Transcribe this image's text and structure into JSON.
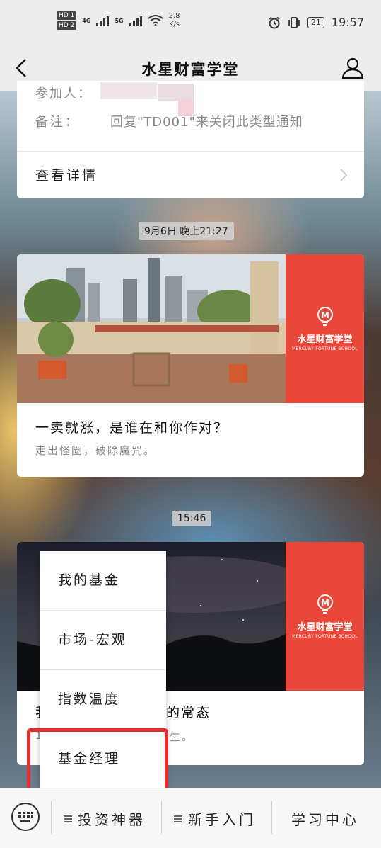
{
  "status_bar": {
    "hd1": "HD 1",
    "hd2": "HD 2",
    "net1": "4G",
    "net2": "5G",
    "speed": "2.8",
    "speed_unit": "K/s",
    "battery": "21",
    "time": "19:57"
  },
  "title_bar": {
    "title": "水星财富学堂"
  },
  "notice_card": {
    "partial_row_label": "参加人：",
    "remark_label": "备注：",
    "remark_value": "回复\"TD001\"来关闭此类型通知",
    "detail_link": "查看详情"
  },
  "messages": [
    {
      "timestamp": "9月6日 晚上21:27",
      "brand_name": "水星财富学堂",
      "brand_sub": "MERCURY FORTUNE SCHOOL",
      "title": "一卖就涨，是谁在和你作对？",
      "description": "走出怪圈，破除魔咒。"
    },
    {
      "timestamp": "15:46",
      "brand_name": "水星财富学堂",
      "brand_sub": "MERCURY FORTUNE SCHOOL",
      "title_partial_left": "我",
      "title_partial_right": "者的常态",
      "description_partial_left": "1",
      "description_partial_right": "生。"
    }
  ],
  "popup_menu": {
    "items": [
      "我的基金",
      "市场-宏观",
      "指数温度",
      "基金经理"
    ],
    "highlight_color": "#e52d2d"
  },
  "bottom_menu": {
    "items": [
      "投资神器",
      "新手入门",
      "学习中心"
    ]
  },
  "colors": {
    "brand_red": "#e8473a",
    "bar_bg": "#ededed"
  },
  "icons": {
    "back": "chevron-left-icon",
    "profile": "person-icon",
    "keyboard": "keyboard-icon",
    "menu": "list-icon"
  }
}
